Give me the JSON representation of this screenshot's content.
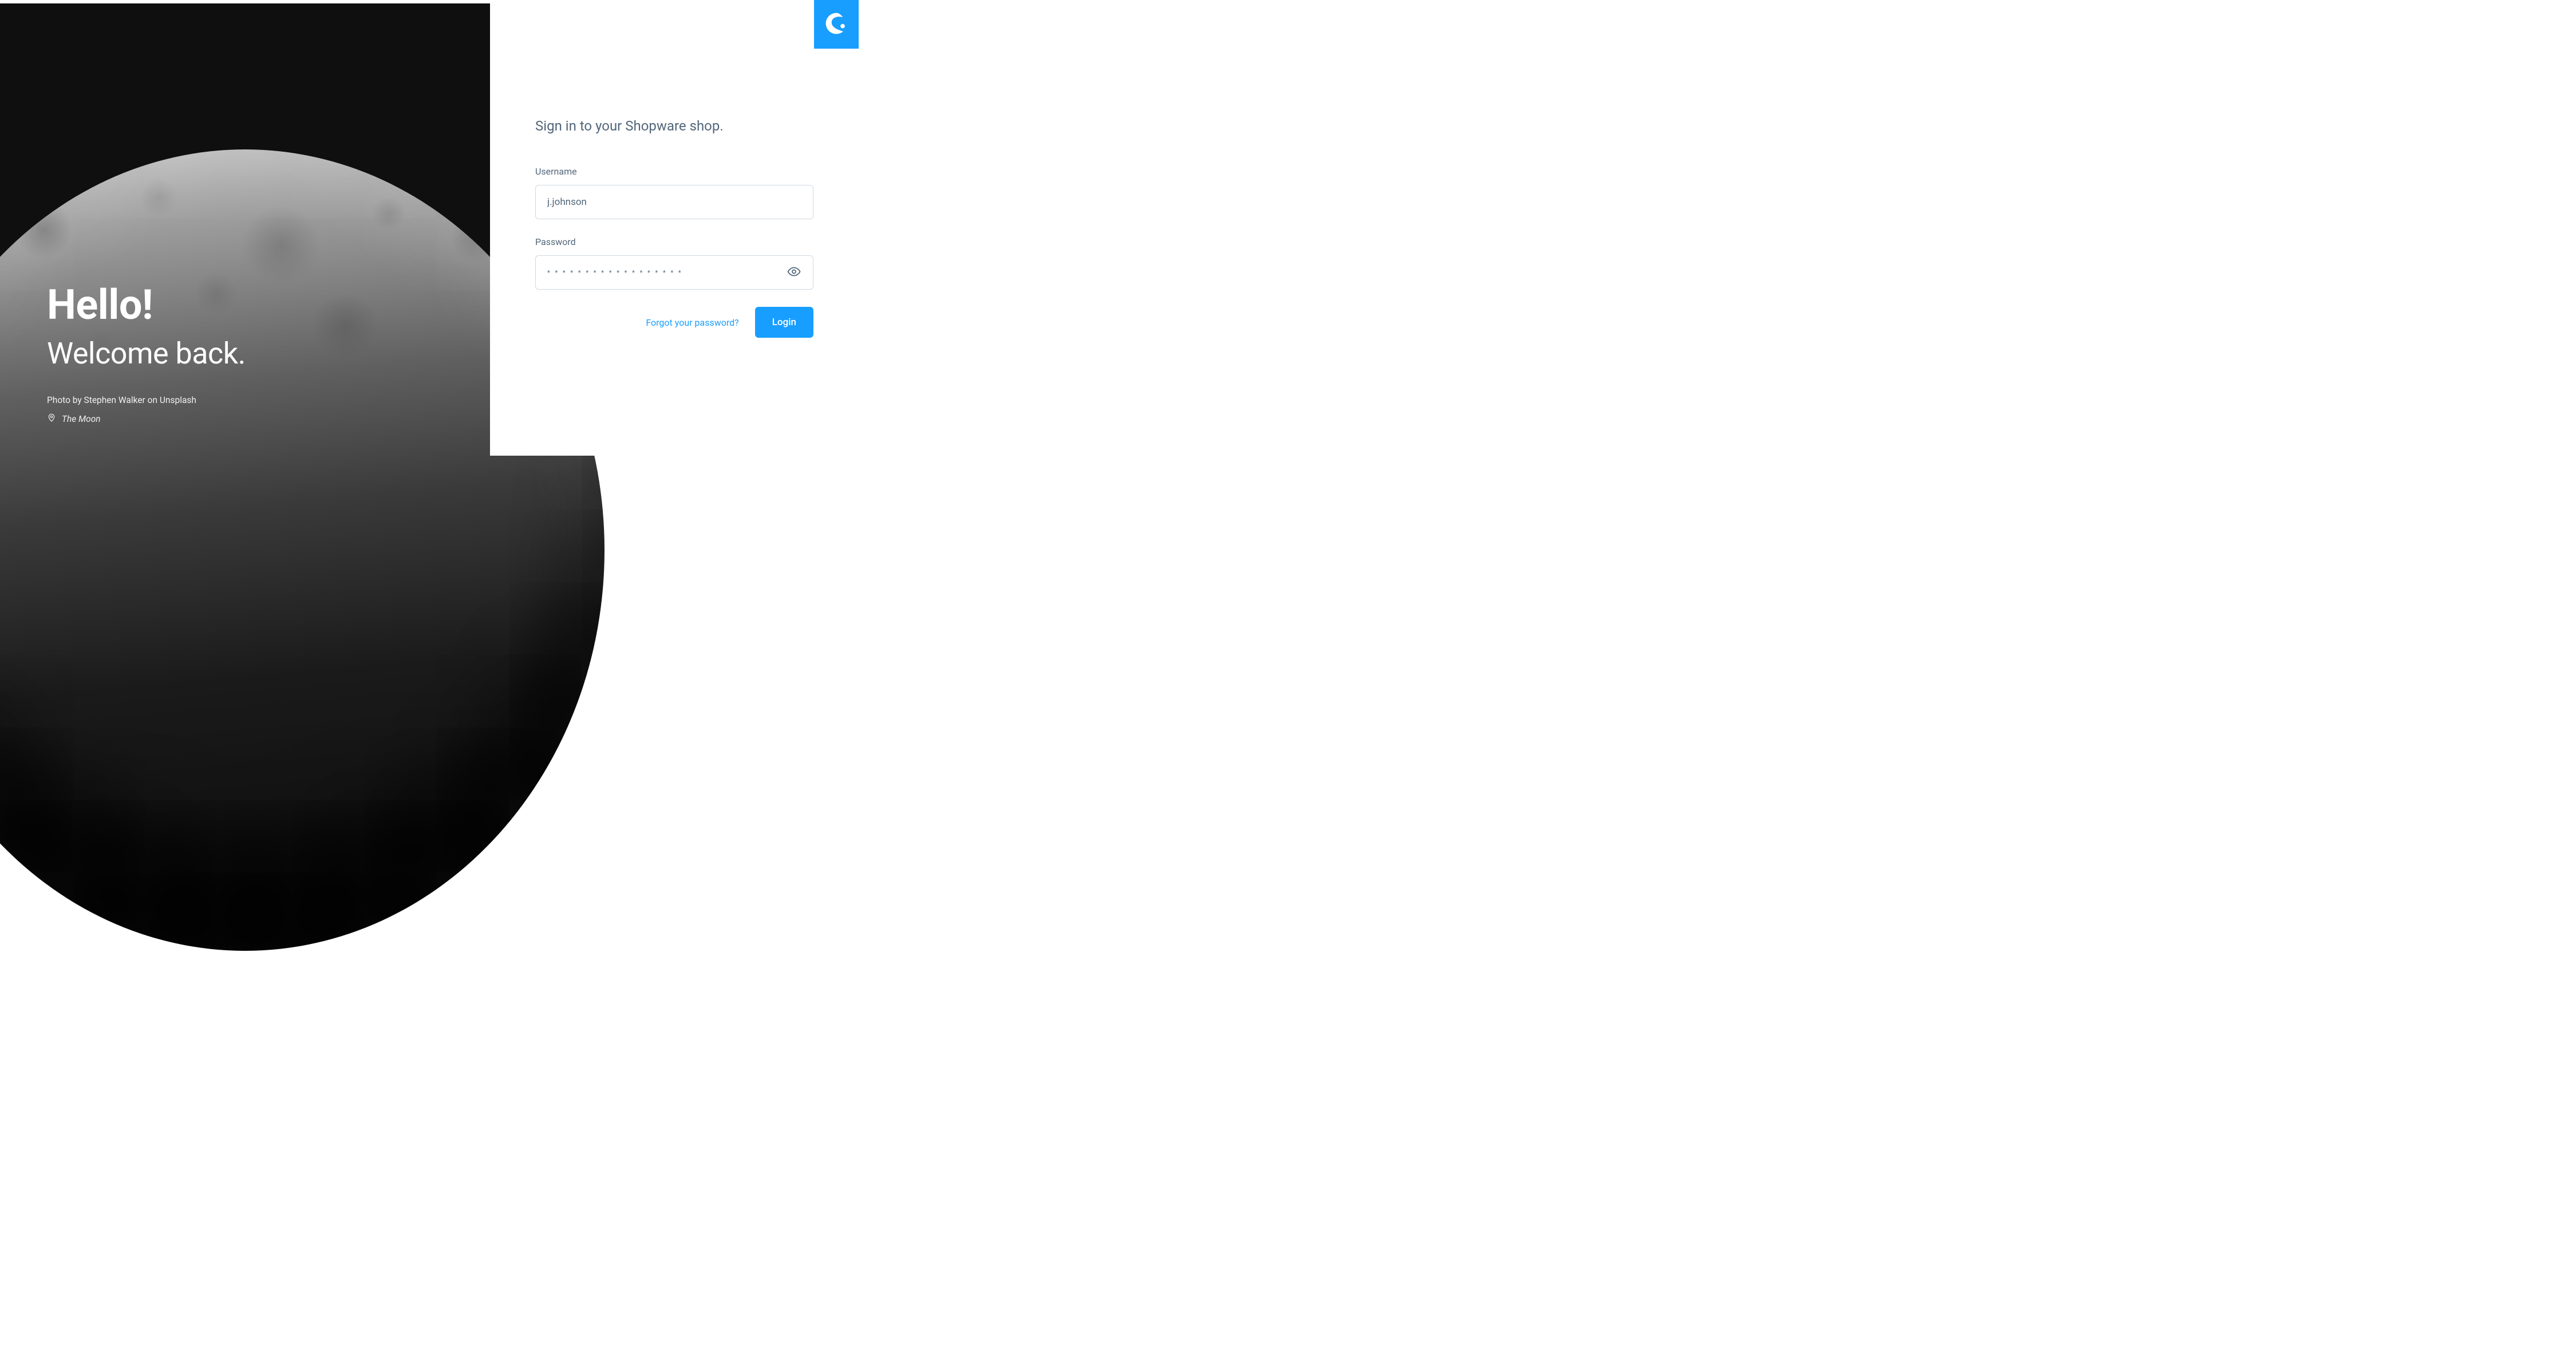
{
  "hero": {
    "title": "Hello!",
    "subtitle": "Welcome back.",
    "photo_credit": "Photo by Stephen Walker on Unsplash",
    "location": "The Moon"
  },
  "form": {
    "heading": "Sign in to your Shopware shop.",
    "username_label": "Username",
    "username_value": "j.johnson",
    "password_label": "Password",
    "password_masked": "* * * * * * * * * * * * * * * * * *",
    "forgot_link": "Forgot your password?",
    "login_button": "Login"
  },
  "colors": {
    "accent": "#189eff"
  }
}
